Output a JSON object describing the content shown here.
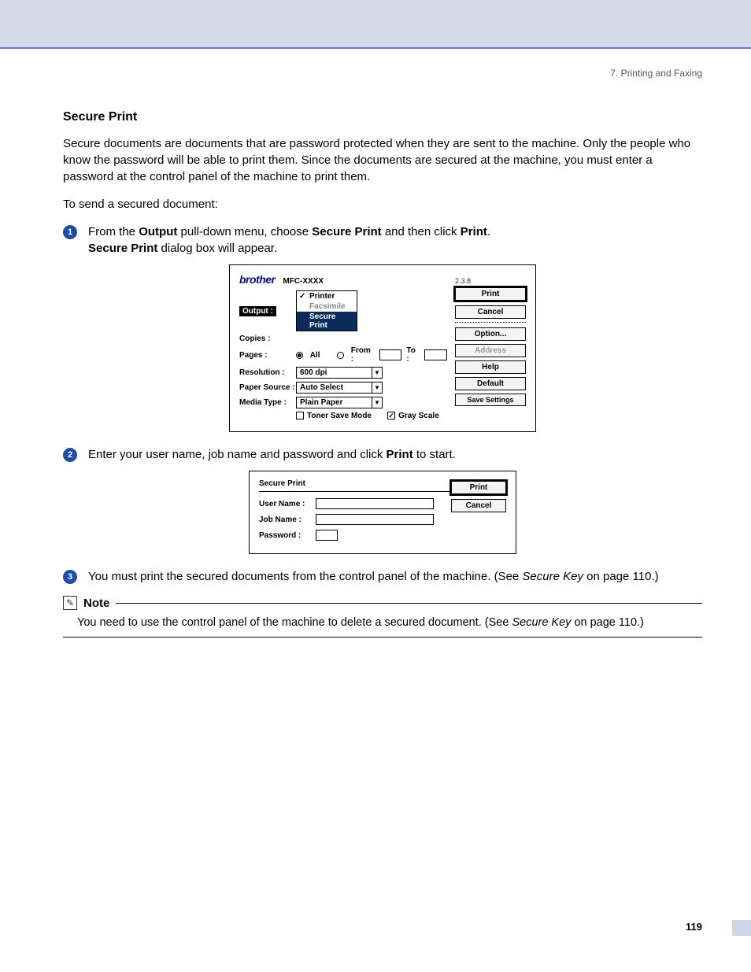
{
  "header": {
    "chapter": "7. Printing and Faxing"
  },
  "section": {
    "title": "Secure Print"
  },
  "paragraphs": {
    "intro": "Secure documents are documents that are password protected when they are sent to the machine. Only the people who know the password will be able to print them. Since the documents are secured at the machine, you must enter a password at the control panel of the machine to print them.",
    "lead": "To send a secured document:"
  },
  "steps": {
    "s1": {
      "num": "1",
      "t1": "From the ",
      "b1": "Output",
      "t2": " pull-down menu, choose ",
      "b2": "Secure Print",
      "t3": " and then click ",
      "b3": "Print",
      "t4": ". ",
      "b4": "Secure Print",
      "t5": " dialog box will appear."
    },
    "s2": {
      "num": "2",
      "t1": "Enter your user name, job name and password and click ",
      "b1": "Print",
      "t2": " to start."
    },
    "s3": {
      "num": "3",
      "t1": "You must print the secured documents from the control panel of the machine. (See ",
      "i1": "Secure Key",
      "t2": " on page 110.)"
    }
  },
  "dialog1": {
    "brand": "brother",
    "model": "MFC-XXXX",
    "version": "2.3.8",
    "labels": {
      "output": "Output :",
      "copies": "Copies :",
      "pages": "Pages :",
      "resolution": "Resolution :",
      "papersource": "Paper Source :",
      "mediatype": "Media Type :",
      "all": "All",
      "from": "From :",
      "to": "To :",
      "tonersave": "Toner Save Mode",
      "grayscale": "Gray Scale"
    },
    "menu": {
      "printer": "Printer",
      "facsimile": "Facsimile",
      "secureprint": "Secure Print"
    },
    "values": {
      "resolution": "600 dpi",
      "papersource": "Auto Select",
      "mediatype": "Plain Paper"
    },
    "buttons": {
      "print": "Print",
      "cancel": "Cancel",
      "option": "Option...",
      "address": "Address",
      "help": "Help",
      "default": "Default",
      "save": "Save Settings"
    }
  },
  "dialog2": {
    "title": "Secure Print",
    "labels": {
      "username": "User Name :",
      "jobname": "Job Name :",
      "password": "Password :"
    },
    "buttons": {
      "print": "Print",
      "cancel": "Cancel"
    }
  },
  "note": {
    "title": "Note",
    "t1": "You need to use the control panel of the machine to delete a secured document. (See ",
    "i1": "Secure Key",
    "t2": " on page 110.)"
  },
  "page_number": "119"
}
